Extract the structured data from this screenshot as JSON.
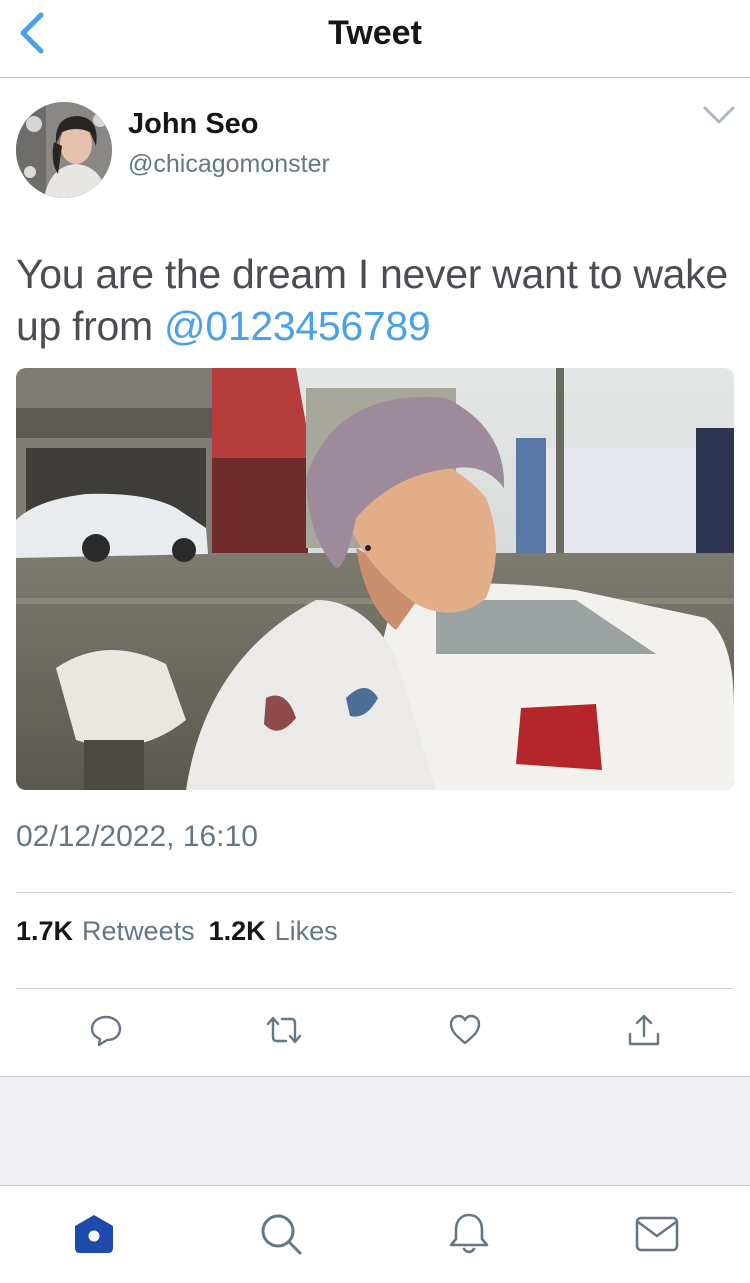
{
  "nav": {
    "title": "Tweet",
    "back_icon": "chevron-left-icon"
  },
  "author": {
    "name": "John Seo",
    "handle": "@chicagomonster"
  },
  "tweet": {
    "text": "You are the dream I never want to wake up from ",
    "mention": "@0123456789",
    "timestamp": "02/12/2022, 16:10"
  },
  "stats": {
    "retweets_count": "1.7K",
    "retweets_label": "Retweets",
    "likes_count": "1.2K",
    "likes_label": "Likes"
  },
  "actions": [
    "reply-icon",
    "retweet-icon",
    "like-icon",
    "share-icon"
  ],
  "tabs": [
    "home-icon",
    "search-icon",
    "notifications-icon",
    "messages-icon"
  ],
  "colors": {
    "accent": "#1da1f2",
    "mention": "#4aa1eb",
    "icon_gray": "#657786",
    "tab_active": "#1e4bab"
  }
}
